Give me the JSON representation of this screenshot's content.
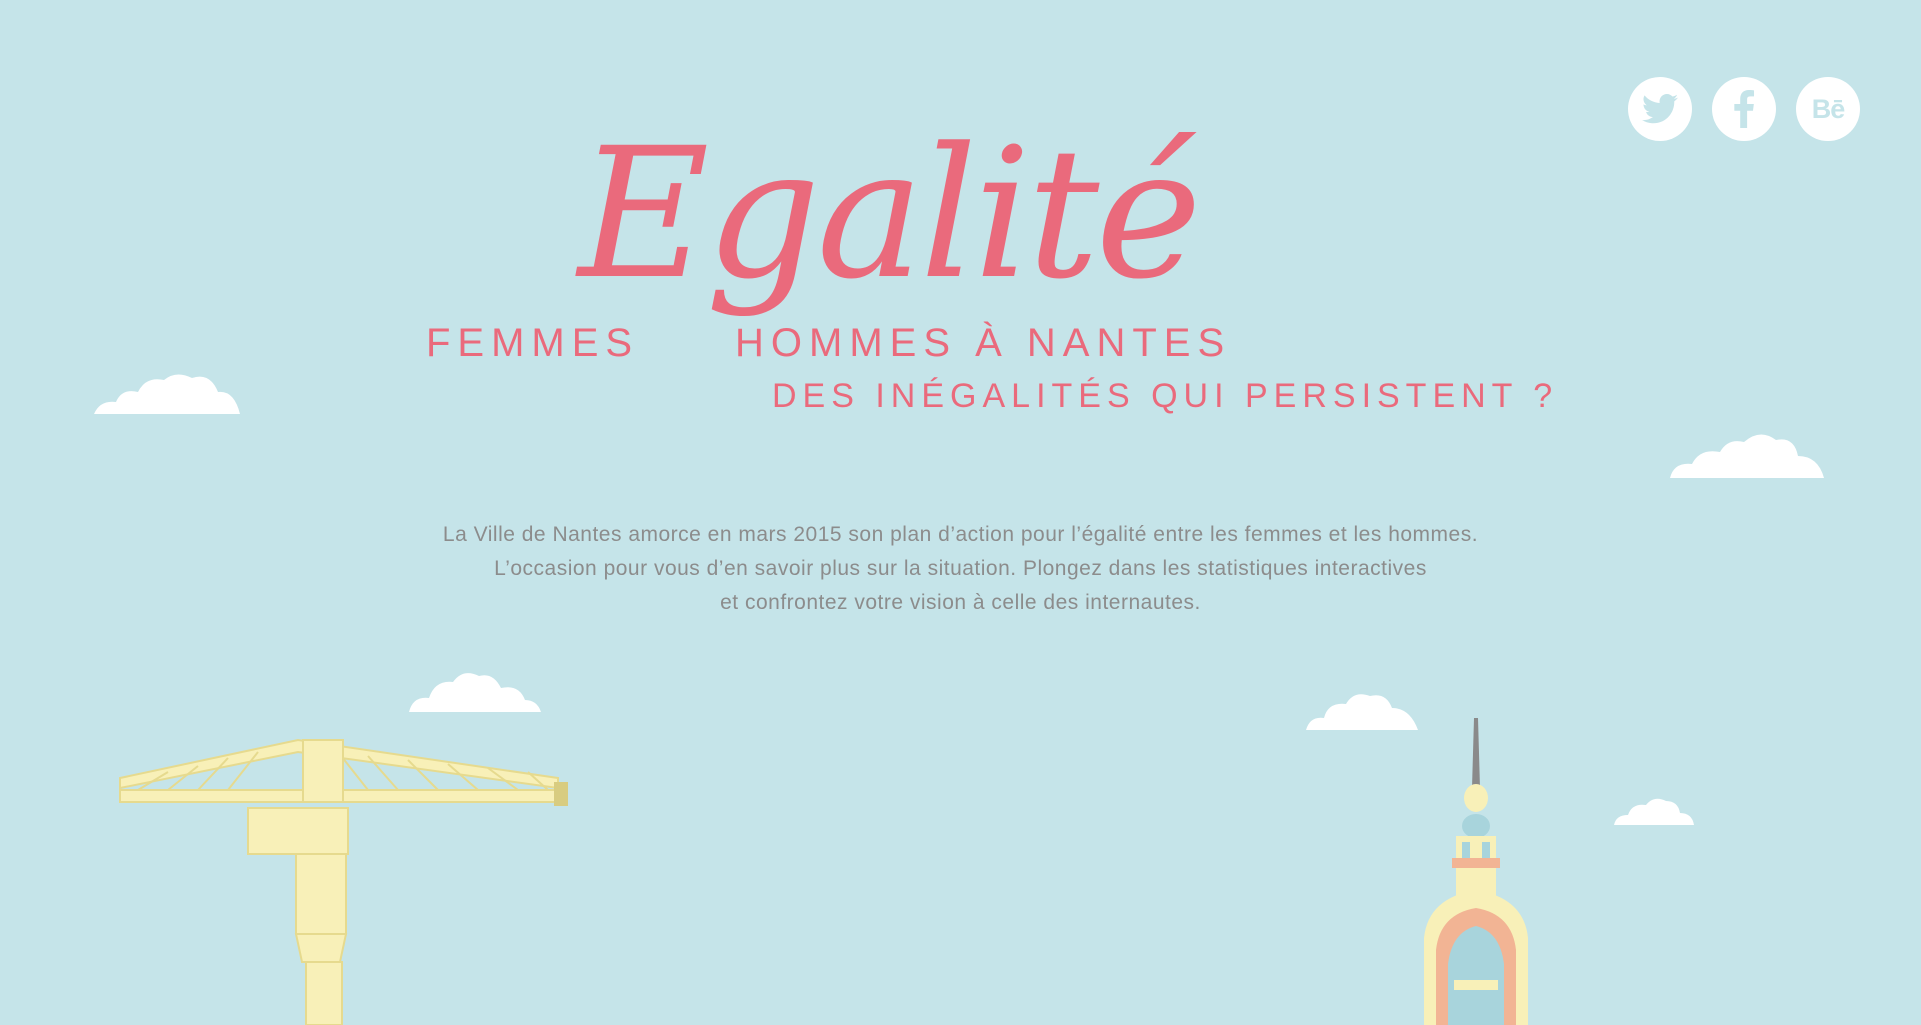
{
  "header": {
    "script_title": "Egalité",
    "line1_left": "FEMMES",
    "line1_right": "HOMMES À NANTES",
    "line2": "DES INÉGALITÉS QUI PERSISTENT ?"
  },
  "intro": {
    "line1": "La Ville de Nantes amorce en mars 2015 son plan d’action pour l’égalité entre les femmes et les hommes.",
    "line2": "L’occasion pour vous d’en savoir plus sur la situation. Plongez dans les statistiques interactives",
    "line3": "et confrontez votre vision à celle des internautes."
  },
  "social": {
    "twitter_icon": "twitter-icon",
    "facebook_icon": "facebook-icon",
    "behance_label": "Bē"
  },
  "colors": {
    "background": "#c5e4e9",
    "accent": "#ea6a7c",
    "text_muted": "#8c8c8c",
    "crane_yellow": "#f8f0b8",
    "cloud": "#ffffff"
  }
}
